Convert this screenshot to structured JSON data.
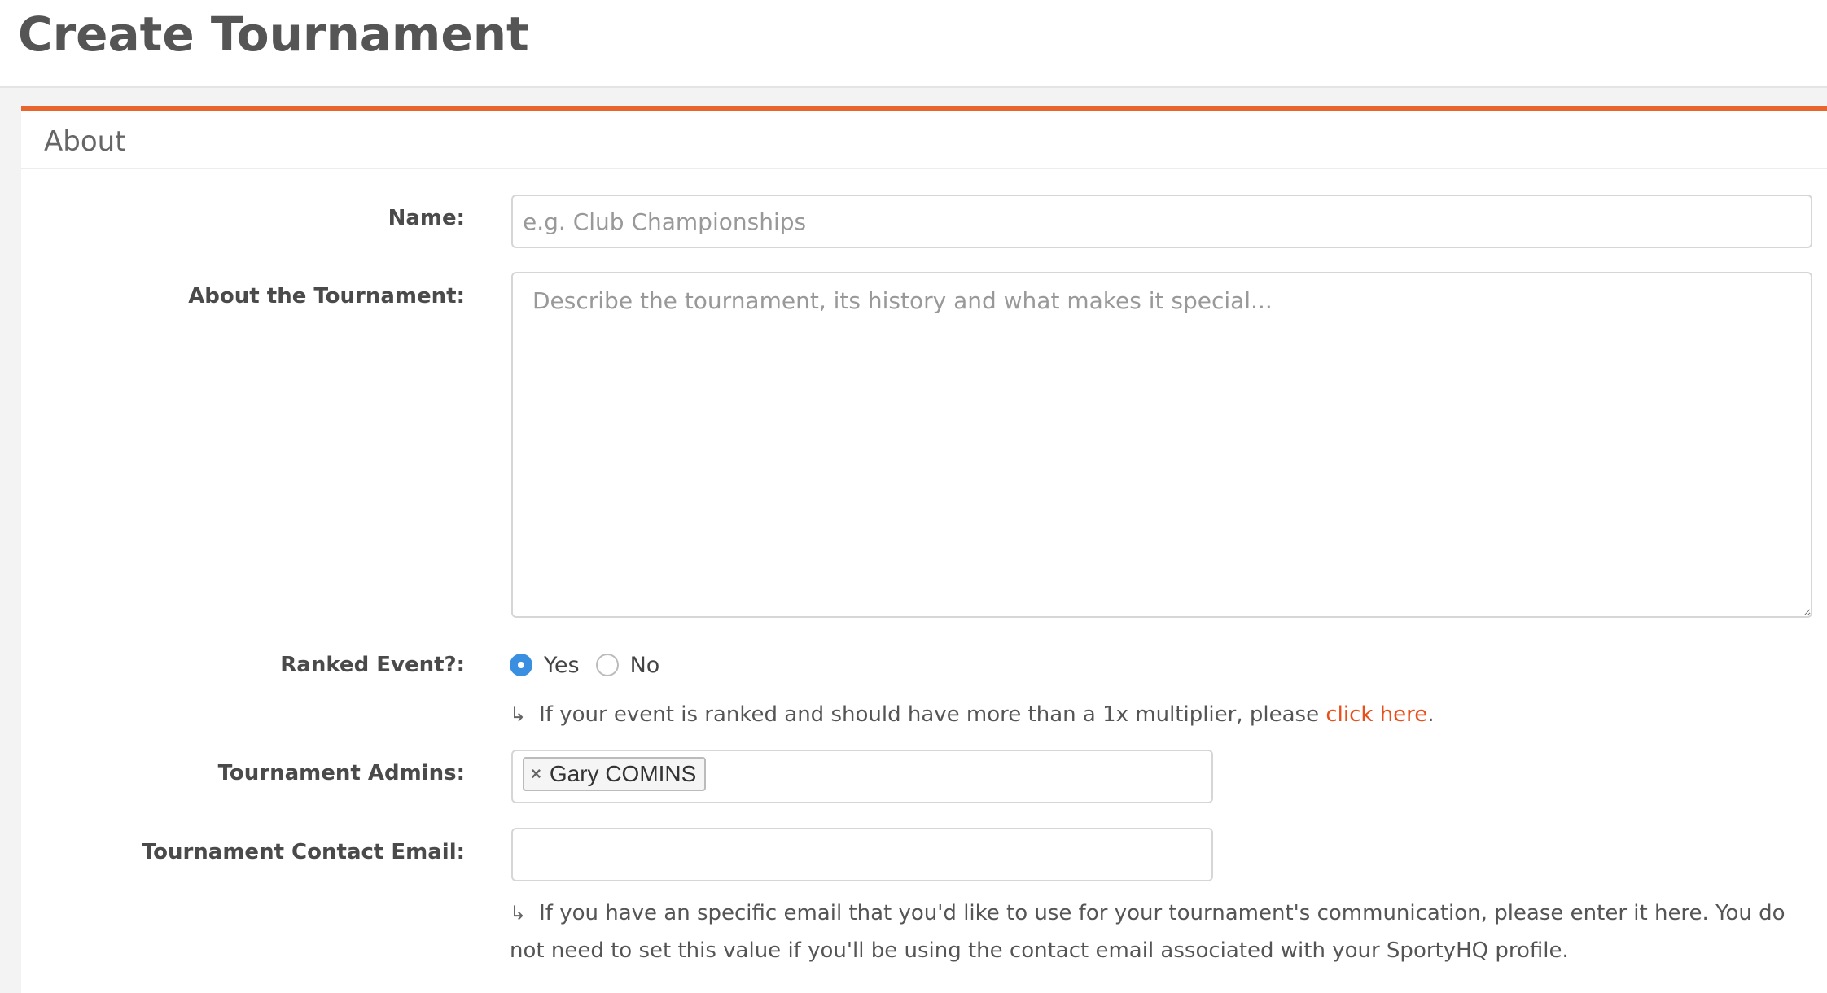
{
  "page": {
    "title": "Create Tournament"
  },
  "section": {
    "title": "About"
  },
  "form": {
    "name": {
      "label": "Name:",
      "placeholder": "e.g. Club Championships",
      "value": ""
    },
    "about": {
      "label": "About the Tournament:",
      "placeholder": "Describe the tournament, its history and what makes it special...",
      "value": ""
    },
    "ranked": {
      "label": "Ranked Event?:",
      "options": [
        {
          "label": "Yes",
          "checked": true
        },
        {
          "label": "No",
          "checked": false
        }
      ],
      "hint_prefix": "If your event is ranked and should have more than a 1x multiplier, please ",
      "hint_link": "click here",
      "hint_suffix": "."
    },
    "admins": {
      "label": "Tournament Admins:",
      "tags": [
        {
          "remove": "×",
          "label": "Gary COMINS"
        }
      ]
    },
    "contact_email": {
      "label": "Tournament Contact Email:",
      "value": "",
      "hint": "If you have an specific email that you'd like to use for your tournament's communication, please enter it here. You do not need to set this value if you'll be using the contact email associated with your SportyHQ profile."
    }
  },
  "icons": {
    "hint_arrow": "↳",
    "radio_checked": "radio-checked-icon",
    "radio_unchecked": "radio-unchecked-icon",
    "tag_remove": "remove-icon"
  },
  "colors": {
    "accent": "#e8662d",
    "link": "#e8501b",
    "radio_selected": "#3b8fe0"
  }
}
